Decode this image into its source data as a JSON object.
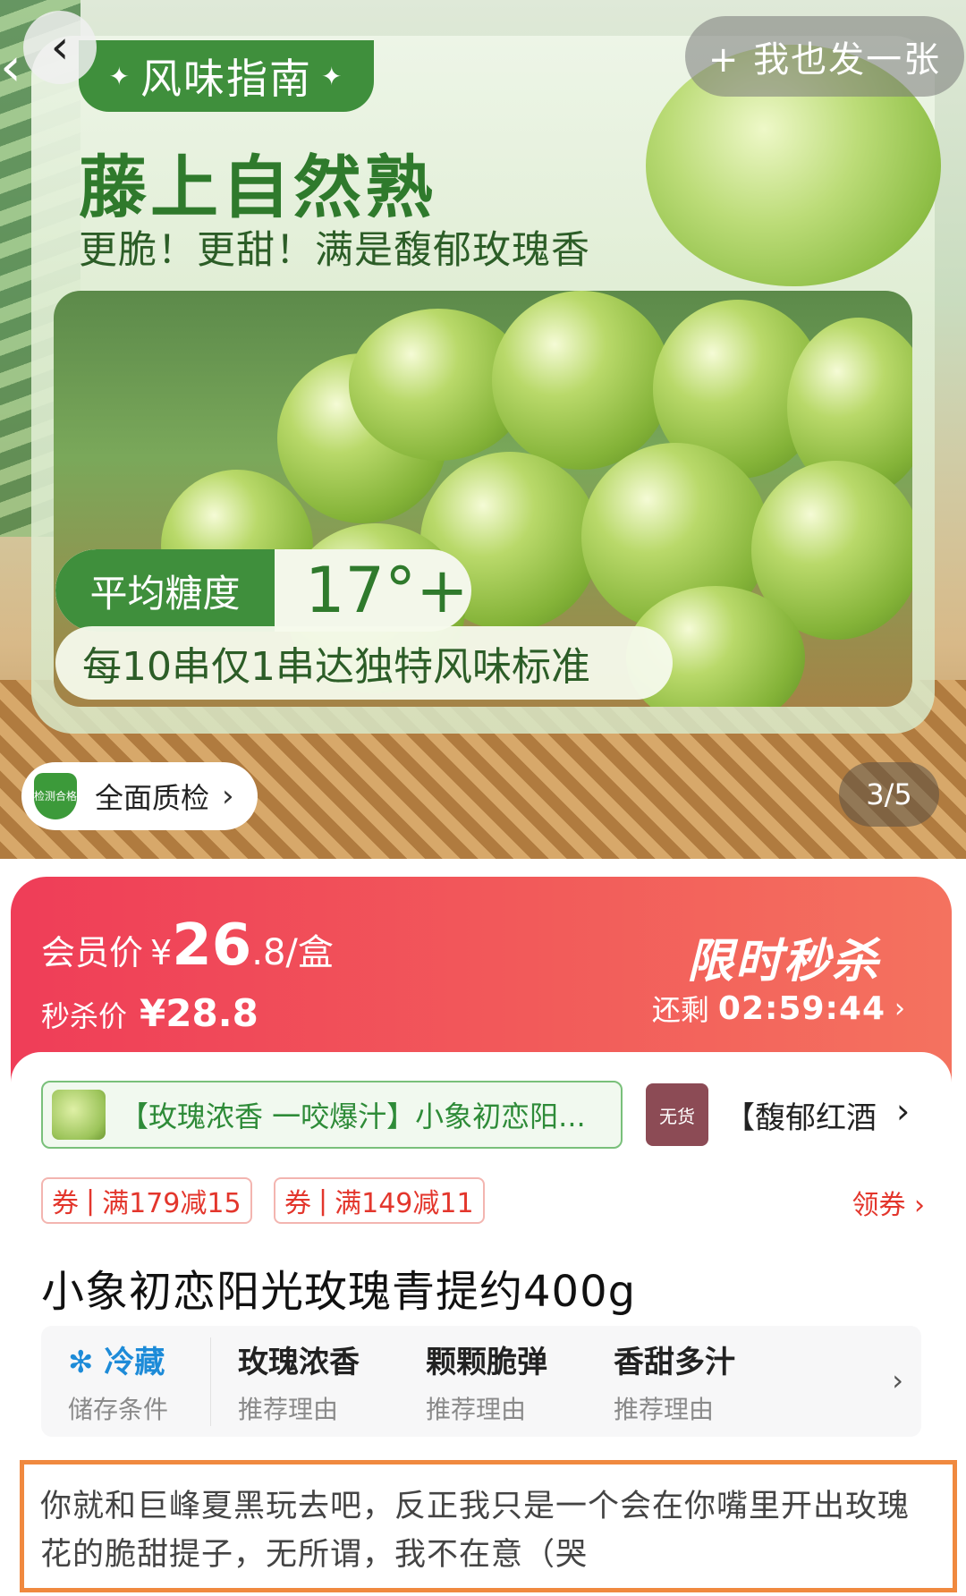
{
  "hero": {
    "banner_tag": "风味指南",
    "headline": "藤上自然熟",
    "subline": "更脆！更甜！满是馥郁玫瑰香",
    "sugar_label": "平均糖度",
    "sugar_value": "17°+",
    "standard_text": "每10串仅1串达独特风味标准",
    "post_button": "+ 我也发一张",
    "qc_label": "全面质检",
    "qc_badge": "检测合格",
    "page_counter": "3/5"
  },
  "price": {
    "member_label": "会员价",
    "currency": "¥",
    "member_price": "26",
    "member_price_decimal": ".8/盒",
    "flash_label": "秒杀价",
    "flash_price": "¥28.8",
    "limited_title": "限时秒杀",
    "countdown_label": "还剩",
    "countdown_time": "02:59:44"
  },
  "variants": {
    "selected": "【玫瑰浓香 一咬爆汁】小象初恋阳...",
    "other_badge": "无货",
    "other": "【馥郁红酒"
  },
  "coupons": [
    {
      "tag": "券",
      "text": "满179减15"
    },
    {
      "tag": "券",
      "text": "满149减11"
    }
  ],
  "get_coupon": "领券",
  "product_title": "小象初恋阳光玫瑰青提约400g",
  "attributes": [
    {
      "value": "冷藏",
      "key": "储存条件",
      "icon": "snowflake-icon"
    },
    {
      "value": "玫瑰浓香",
      "key": "推荐理由"
    },
    {
      "value": "颗颗脆弹",
      "key": "推荐理由"
    },
    {
      "value": "香甜多汁",
      "key": "推荐理由"
    }
  ],
  "caption": "你就和巨峰夏黑玩去吧，反正我只是一个会在你嘴里开出玫瑰花的脆甜提子，无所谓，我不在意（哭",
  "colors": {
    "brand_green": "#3f8f3c",
    "sale_red": "#ef3d58",
    "coupon_red": "#e3362c",
    "caption_border": "#f0893f"
  }
}
